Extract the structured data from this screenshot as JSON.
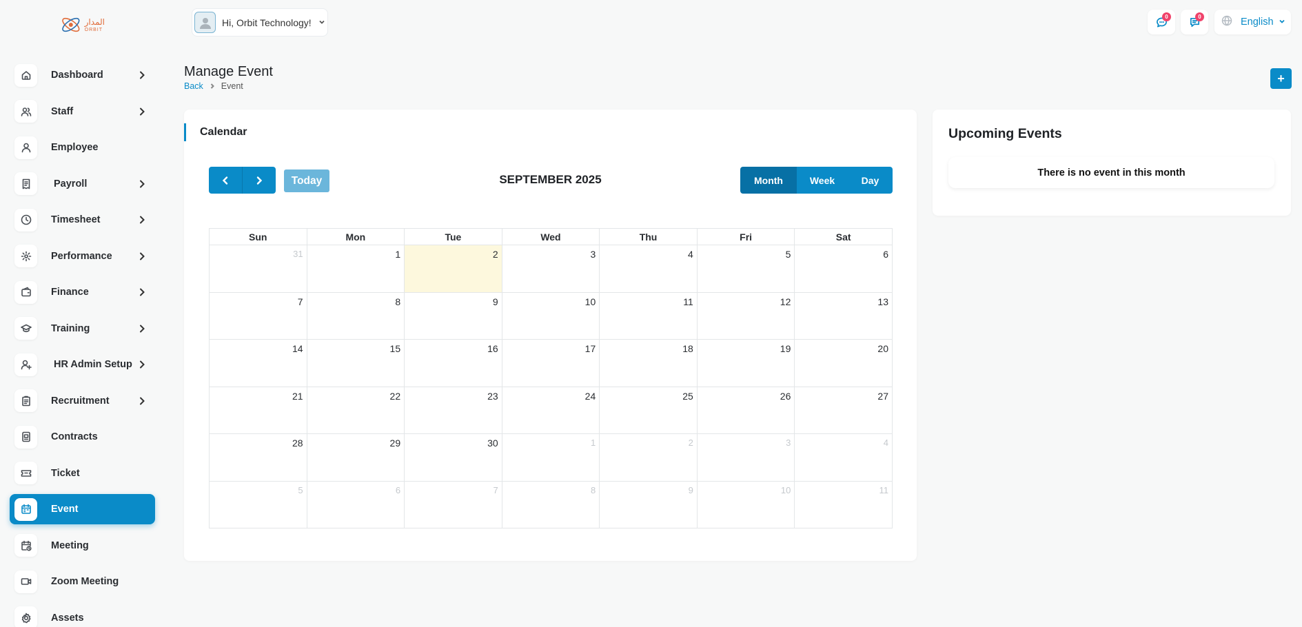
{
  "brand": {
    "logo_ar": "المدار",
    "logo_en": "ORBIT",
    "accent": "#0a8bc8",
    "badge_color": "#f0436b",
    "today_highlight": "#fdf8dd"
  },
  "topbar": {
    "greeting": "Hi, Orbit Technology!",
    "messages_badge": "0",
    "notifications_badge": "0",
    "language": "English"
  },
  "sidebar": {
    "items": [
      {
        "label": "Dashboard",
        "icon": "home-icon",
        "chevron": true
      },
      {
        "label": "Staff",
        "icon": "users-icon",
        "chevron": true
      },
      {
        "label": "Employee",
        "icon": "user-icon",
        "chevron": false
      },
      {
        "label": "Payroll",
        "icon": "receipt-icon",
        "chevron": true
      },
      {
        "label": "Timesheet",
        "icon": "clock-icon",
        "chevron": true
      },
      {
        "label": "Performance",
        "icon": "performance-icon",
        "chevron": true
      },
      {
        "label": "Finance",
        "icon": "wallet-icon",
        "chevron": true
      },
      {
        "label": "Training",
        "icon": "graduation-cap-icon",
        "chevron": true
      },
      {
        "label": "HR Admin Setup",
        "icon": "user-plus-icon",
        "chevron": true
      },
      {
        "label": "Recruitment",
        "icon": "clipboard-icon",
        "chevron": true
      },
      {
        "label": "Contracts",
        "icon": "contract-icon",
        "chevron": false
      },
      {
        "label": "Ticket",
        "icon": "ticket-icon",
        "chevron": false
      },
      {
        "label": "Event",
        "icon": "calendar-icon",
        "chevron": false,
        "active": true
      },
      {
        "label": "Meeting",
        "icon": "calendar-clock-icon",
        "chevron": false
      },
      {
        "label": "Zoom Meeting",
        "icon": "video-icon",
        "chevron": false
      },
      {
        "label": "Assets",
        "icon": "gear-icon",
        "chevron": false
      }
    ]
  },
  "page": {
    "title": "Manage Event",
    "breadcrumb_back": "Back",
    "breadcrumb_current": "Event",
    "add_label": "+"
  },
  "calendar": {
    "card_title": "Calendar",
    "today_label": "Today",
    "month_title": "SEPTEMBER 2025",
    "views": [
      "Month",
      "Week",
      "Day"
    ],
    "active_view": "Month",
    "weekdays": [
      "Sun",
      "Mon",
      "Tue",
      "Wed",
      "Thu",
      "Fri",
      "Sat"
    ],
    "weeks": [
      [
        {
          "d": "31",
          "other": true
        },
        {
          "d": "1"
        },
        {
          "d": "2",
          "today": true
        },
        {
          "d": "3"
        },
        {
          "d": "4"
        },
        {
          "d": "5"
        },
        {
          "d": "6"
        }
      ],
      [
        {
          "d": "7"
        },
        {
          "d": "8"
        },
        {
          "d": "9"
        },
        {
          "d": "10"
        },
        {
          "d": "11"
        },
        {
          "d": "12"
        },
        {
          "d": "13"
        }
      ],
      [
        {
          "d": "14"
        },
        {
          "d": "15"
        },
        {
          "d": "16"
        },
        {
          "d": "17"
        },
        {
          "d": "18"
        },
        {
          "d": "19"
        },
        {
          "d": "20"
        }
      ],
      [
        {
          "d": "21"
        },
        {
          "d": "22"
        },
        {
          "d": "23"
        },
        {
          "d": "24"
        },
        {
          "d": "25"
        },
        {
          "d": "26"
        },
        {
          "d": "27"
        }
      ],
      [
        {
          "d": "28"
        },
        {
          "d": "29"
        },
        {
          "d": "30"
        },
        {
          "d": "1",
          "other": true
        },
        {
          "d": "2",
          "other": true
        },
        {
          "d": "3",
          "other": true
        },
        {
          "d": "4",
          "other": true
        }
      ],
      [
        {
          "d": "5",
          "other": true
        },
        {
          "d": "6",
          "other": true
        },
        {
          "d": "7",
          "other": true
        },
        {
          "d": "8",
          "other": true
        },
        {
          "d": "9",
          "other": true
        },
        {
          "d": "10",
          "other": true
        },
        {
          "d": "11",
          "other": true
        }
      ]
    ]
  },
  "upcoming": {
    "title": "Upcoming Events",
    "empty_text": "There is no event in this month"
  }
}
